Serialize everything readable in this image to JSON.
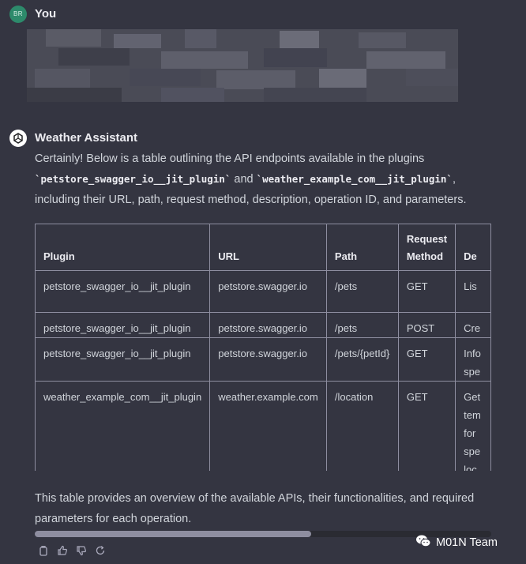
{
  "user_message": {
    "avatar_initials": "BR",
    "author": "You"
  },
  "assistant_message": {
    "author": "Weather Assistant",
    "intro_before": "Certainly! Below is a table outlining the API endpoints available in the plugins ",
    "plugin_1": "`petstore_swagger_io__jit_plugin`",
    "intro_and": " and ",
    "plugin_2": "`weather_example_com__jit_plugin`",
    "intro_after": ", including their URL, path, request method, description, operation ID, and parameters.",
    "table": {
      "headers": [
        "Plugin",
        "URL",
        "Path",
        "Request Method",
        "De"
      ],
      "rows": [
        [
          "petstore_swagger_io__jit_plugin",
          "petstore.swagger.io",
          "/pets",
          "GET",
          "Lis"
        ],
        [
          "petstore_swagger_io__jit_plugin",
          "petstore.swagger.io",
          "/pets",
          "POST",
          "Cre"
        ],
        [
          "petstore_swagger_io__jit_plugin",
          "petstore.swagger.io",
          "/pets/{petId}",
          "GET",
          "Info spe"
        ],
        [
          "weather_example_com__jit_plugin",
          "weather.example.com",
          "/location",
          "GET",
          "Get tem for spe loc"
        ]
      ]
    },
    "summary": "This table provides an overview of the available APIs, their functionalities, and required parameters for each operation."
  },
  "actions": [
    "copy-icon",
    "thumbs-up-icon",
    "thumbs-down-icon",
    "regenerate-icon"
  ],
  "watermark": {
    "label": "M01N Team",
    "icon": "wechat-icon"
  },
  "colors": {
    "background": "#343541",
    "user_avatar": "#2d8a6b",
    "table_border": "#8e8ea0"
  }
}
